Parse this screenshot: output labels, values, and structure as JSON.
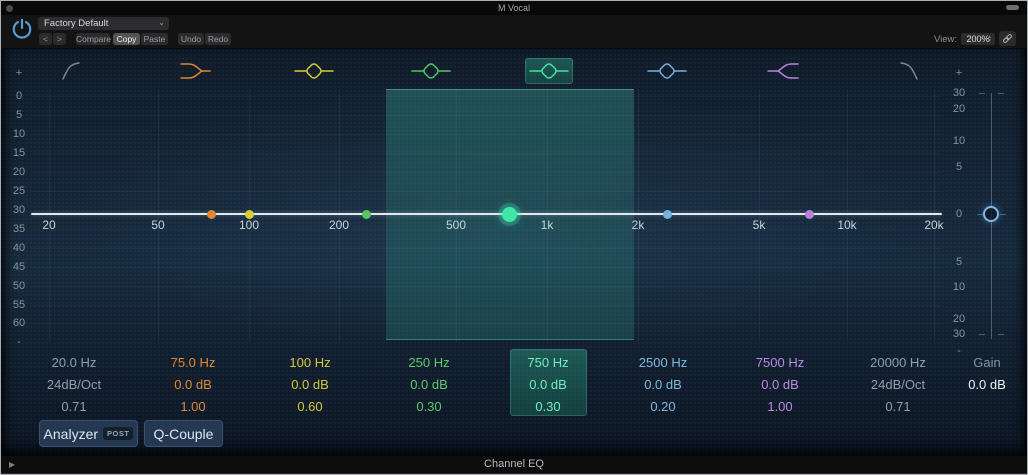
{
  "window": {
    "title": "M Vocal",
    "plugin_name": "Channel EQ"
  },
  "toolbar": {
    "preset": "Factory Default",
    "prev": "<",
    "next": ">",
    "compare": "Compare",
    "copy": "Copy",
    "paste": "Paste",
    "undo": "Undo",
    "redo": "Redo",
    "view_label": "View:",
    "view_value": "200%"
  },
  "eq": {
    "bands": [
      {
        "shape": "highpass",
        "color": "#7d8894",
        "text_color": "#939ea9",
        "freq": "20.0 Hz",
        "gain": "24dB/Oct",
        "q": "0.71",
        "selected": false,
        "enabled": false
      },
      {
        "shape": "low-shelf",
        "color": "#e0862f",
        "text_color": "#db8a36",
        "freq": "75.0 Hz",
        "gain": "0.0 dB",
        "q": "1.00",
        "selected": false,
        "enabled": true
      },
      {
        "shape": "bell",
        "color": "#d9cd31",
        "text_color": "#d2c83c",
        "freq": "100 Hz",
        "gain": "0.0 dB",
        "q": "0.60",
        "selected": false,
        "enabled": true
      },
      {
        "shape": "bell",
        "color": "#54c763",
        "text_color": "#5dc96b",
        "freq": "250 Hz",
        "gain": "0.0 dB",
        "q": "0.30",
        "selected": false,
        "enabled": true
      },
      {
        "shape": "bell",
        "color": "#3fe6a7",
        "text_color": "#6fefbf",
        "freq": "750 Hz",
        "gain": "0.0 dB",
        "q": "0.30",
        "selected": true,
        "enabled": true
      },
      {
        "shape": "bell",
        "color": "#74b4dc",
        "text_color": "#7fbade",
        "freq": "2500 Hz",
        "gain": "0.0 dB",
        "q": "0.20",
        "selected": false,
        "enabled": true
      },
      {
        "shape": "high-shelf",
        "color": "#b983dd",
        "text_color": "#b88ede",
        "freq": "7500 Hz",
        "gain": "0.0 dB",
        "q": "1.00",
        "selected": false,
        "enabled": true
      },
      {
        "shape": "lowpass",
        "color": "#7d8894",
        "text_color": "#939ea9",
        "freq": "20000 Hz",
        "gain": "24dB/Oct",
        "q": "0.71",
        "selected": false,
        "enabled": false
      }
    ],
    "freq_ticks": [
      "20",
      "50",
      "100",
      "200",
      "500",
      "1k",
      "2k",
      "5k",
      "10k",
      "20k"
    ],
    "db_scale_left": [
      "+",
      "0",
      "5",
      "10",
      "15",
      "20",
      "25",
      "30",
      "35",
      "40",
      "45",
      "50",
      "55",
      "60",
      "-"
    ],
    "gain_scale_right": [
      "+",
      "30",
      "20",
      "10",
      "5",
      "0",
      "5",
      "10",
      "20",
      "30",
      "-"
    ],
    "master_gain": {
      "label": "Gain",
      "value": "0.0 dB"
    }
  },
  "controls": {
    "analyzer": "Analyzer",
    "analyzer_mode": "POST",
    "q_couple": "Q-Couple"
  }
}
